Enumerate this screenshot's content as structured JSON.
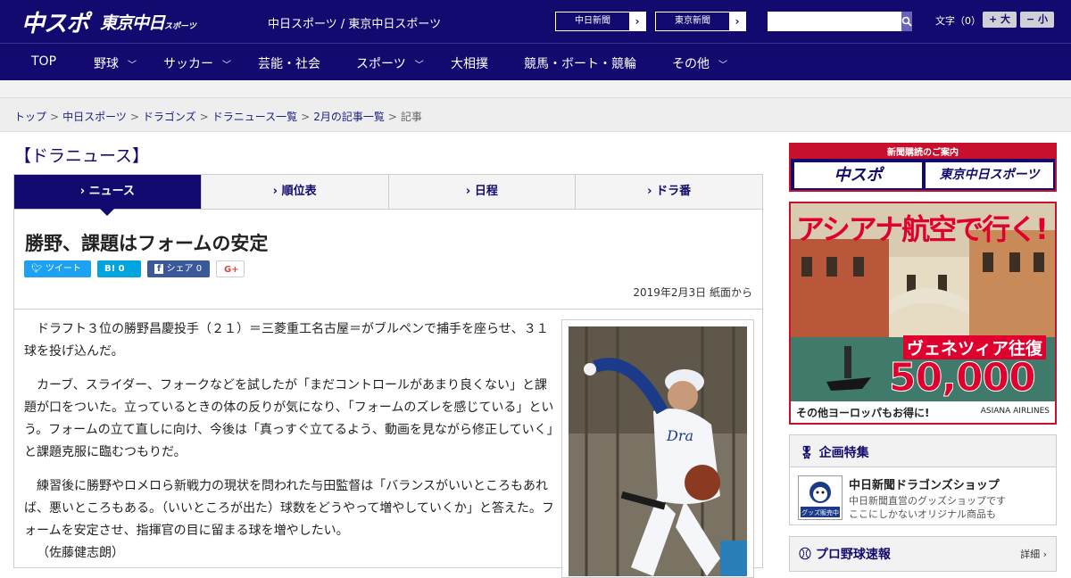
{
  "header": {
    "logo_chuspo": "中スポ",
    "logo_tokyo": "東京中日",
    "logo_tokyo_small": "スポーツ",
    "site_name": "中日スポーツ / 東京中日スポーツ",
    "paper_buttons": [
      "中日新聞",
      "東京新聞"
    ],
    "search_placeholder": "",
    "font_label": "文字（0）",
    "font_bigger": "+ 大",
    "font_smaller": "− 小"
  },
  "nav": {
    "items": [
      "TOP",
      "野球",
      "サッカー",
      "芸能・社会",
      "スポーツ",
      "大相撲",
      "競馬・ボート・競輪",
      "その他"
    ]
  },
  "breadcrumb": {
    "links": [
      "トップ",
      "中日スポーツ",
      "ドラゴンズ",
      "ドラニュース一覧",
      "2月の記事一覧"
    ],
    "current": "記事"
  },
  "section_title": "【ドラニュース】",
  "tabs": [
    "ニュース",
    "順位表",
    "日程",
    "ドラ番"
  ],
  "article": {
    "headline": "勝野、課題はフォームの安定",
    "social": {
      "tweet": "ツイート",
      "hatena": "B! 0",
      "facebook": "シェア 0",
      "gplus": "G+"
    },
    "date": "2019年2月3日 紙面から",
    "paragraphs": [
      "ドラフト３位の勝野昌慶投手（２１）＝三菱重工名古屋＝がブルペンで捕手を座らせ、３１球を投げ込んだ。",
      "カーブ、スライダー、フォークなどを試したが「まだコントロールがあまり良くない」と課題が口をついた。立っているときの体の反りが気になり、「フォームのズレを感じている」という。フォームの立て直しに向け、今後は「真っすぐ立てるよう、動画を見ながら修正していく」と課題克服に臨むつもりだ。",
      "練習後に勝野やロメロら新戦力の現状を問われた与田監督は「バランスがいいところもあれば、悪いところもある。（いいところが出た）球数をどうやって増やしていくか」と答えた。フォームを安定させ、指揮官の目に留まる球を増やしたい。",
      "（佐藤健志朗）"
    ]
  },
  "sidebar": {
    "subscribe_caption": "新聞購読のご案内",
    "subscribe_buttons": [
      "中スポ",
      "東京中日スポーツ"
    ],
    "ad": {
      "headline": "アシアナ航空で行く!",
      "route": "ヴェネツィア往復",
      "price": "50,000円〜",
      "footer": "その他ヨーロッパもお得に!",
      "brand": "ASIANA AIRLINES"
    },
    "feature": {
      "title": "企画特集",
      "thumb_label": "グッズ販売中",
      "item_title": "中日新聞ドラゴンズショップ",
      "desc1": "中日新聞直営のグッズショップです",
      "desc2": "ここにしかないオリジナル商品も"
    },
    "pro": {
      "title": "プロ野球速報",
      "more": "詳細 ›"
    }
  },
  "colors": {
    "brand_navy": "#120a6e",
    "accent_red": "#c8102e",
    "link": "#1a237e"
  }
}
